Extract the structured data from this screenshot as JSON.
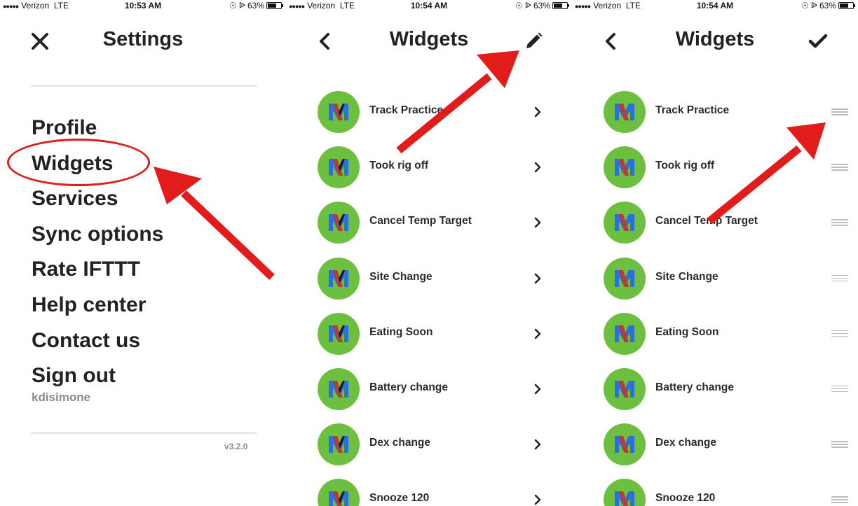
{
  "status_bars": [
    {
      "carrier": "Verizon",
      "network": "LTE",
      "time": "10:53 AM",
      "battery": "63%",
      "battery_level": 0.63
    },
    {
      "carrier": "Verizon",
      "network": "LTE",
      "time": "10:54 AM",
      "battery": "63%",
      "battery_level": 0.63
    },
    {
      "carrier": "Verizon",
      "network": "LTE",
      "time": "10:54 AM",
      "battery": "63%",
      "battery_level": 0.63
    }
  ],
  "settings": {
    "title": "Settings",
    "close_icon": "close-icon",
    "menu": [
      "Profile",
      "Widgets",
      "Services",
      "Sync options",
      "Rate IFTTT",
      "Help center",
      "Contact us",
      "Sign out"
    ],
    "username": "kdisimone",
    "version": "v3.2.0"
  },
  "widgets_view": {
    "title": "Widgets",
    "back_icon": "chevron-left-icon",
    "action_icon": "pencil-icon"
  },
  "widgets_edit": {
    "title": "Widgets",
    "back_icon": "chevron-left-icon",
    "action_icon": "checkmark-icon"
  },
  "widgets": [
    "Track Practice",
    "Took rig off",
    "Cancel Temp Target",
    "Site Change",
    "Eating Soon",
    "Battery change",
    "Dex change",
    "Snooze 120"
  ],
  "colors": {
    "avatar_green": "#6dbf3f",
    "annotation_red": "#e21b1b",
    "text_dark": "#222222",
    "text_muted": "#8a8a8a"
  }
}
